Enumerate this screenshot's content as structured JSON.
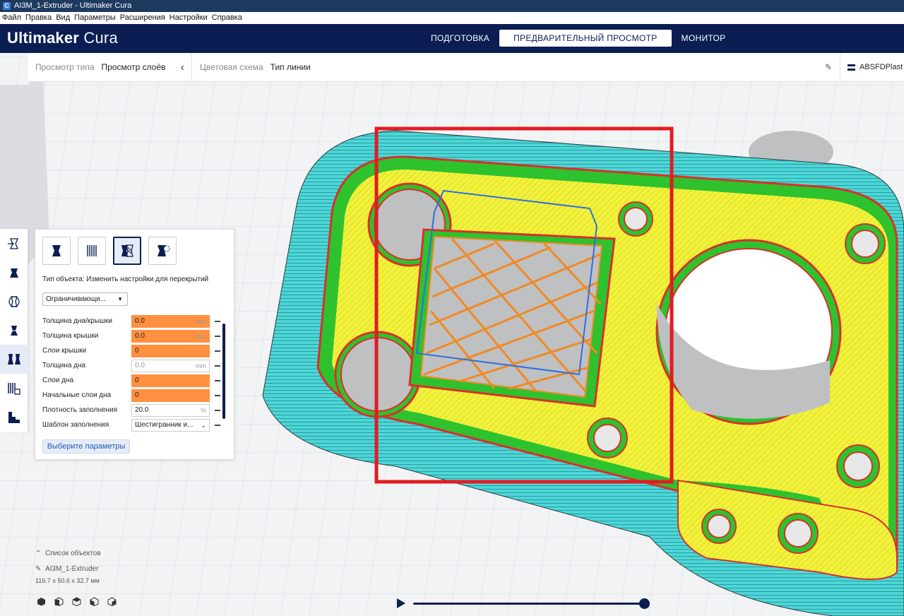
{
  "window": {
    "title": "AI3M_1-Extruder - Ultimaker Cura"
  },
  "menu": [
    "Файл",
    "Правка",
    "Вид",
    "Параметры",
    "Расширения",
    "Настройки",
    "Справка"
  ],
  "header": {
    "logo_bold": "Ultimaker",
    "logo_light": " Cura",
    "stages": [
      {
        "label": "ПОДГОТОВКА",
        "active": false
      },
      {
        "label": "ПРЕДВАРИТЕЛЬНЫЙ ПРОСМОТР",
        "active": true
      },
      {
        "label": "МОНИТОР",
        "active": false
      }
    ]
  },
  "viewbar": {
    "view_type_label": "Просмотр типа",
    "view_type_value": "Просмотр слоёв",
    "scheme_label": "Цветовая схема",
    "scheme_value": "Тип линии",
    "material": "ABSFDPlast"
  },
  "panel": {
    "object_type": "Тип объекта: Изменить настройки для перекрытий",
    "mesh_type": "Ограничивающи...",
    "settings": [
      {
        "label": "Толщина дна/крышки",
        "value": "0.0",
        "unit": "mm",
        "state": "error"
      },
      {
        "label": "Толщина крышки",
        "value": "0.0",
        "unit": "mm",
        "state": "error"
      },
      {
        "label": "Слои крышки",
        "value": "0",
        "unit": "",
        "state": "error"
      },
      {
        "label": "Толщина дна",
        "value": "0.0",
        "unit": "mm",
        "state": "disabled"
      },
      {
        "label": "Слои дна",
        "value": "0",
        "unit": "",
        "state": "error"
      },
      {
        "label": "Начальные слои дна",
        "value": "0",
        "unit": "",
        "state": "error"
      },
      {
        "label": "Плотность заполнения",
        "value": "20.0",
        "unit": "%",
        "state": "normal"
      },
      {
        "label": "Шаблон заполнения",
        "value": "Шестигранник и...",
        "unit": "",
        "state": "dropdown"
      }
    ],
    "select_button": "Выберите параметры"
  },
  "objects": {
    "header": "Список объектов",
    "name": "AI3M_1-Extruder",
    "dimensions": "116.7 x 50.6 x 32.7 мм"
  },
  "colors": {
    "brand": "#0a1e53",
    "skirt": "#4ed6d6",
    "wall_outer": "#d9302b",
    "wall_inner": "#2ec22e",
    "skin": "#f2f23a",
    "infill": "#f08a24",
    "highlight_box": "#e31b23",
    "mesh_outline": "#2f6fe0"
  }
}
